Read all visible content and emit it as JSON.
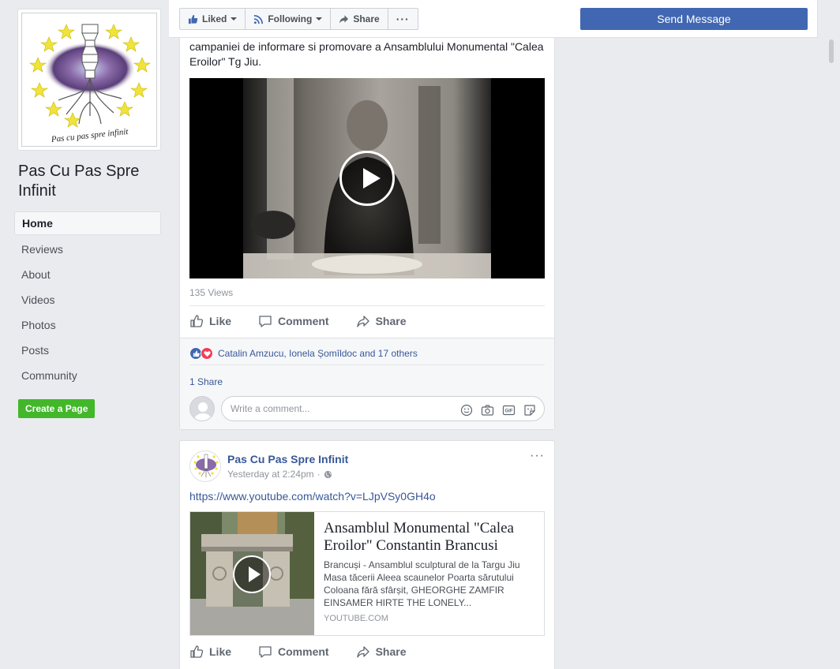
{
  "sidebar": {
    "page_name": "Pas Cu Pas Spre Infinit",
    "logo_text": "Pas cu pas spre infinit",
    "nav": [
      "Home",
      "Reviews",
      "About",
      "Videos",
      "Photos",
      "Posts",
      "Community"
    ],
    "create_page": "Create a Page"
  },
  "toolbar": {
    "liked": "Liked",
    "following": "Following",
    "share": "Share",
    "more": "···",
    "send_message": "Send Message"
  },
  "post1": {
    "text": "campaniei de informare si promovare a Ansamblului Monumental \"Calea Eroilor\" Tg Jiu.",
    "views": "135 Views",
    "actions": {
      "like": "Like",
      "comment": "Comment",
      "share": "Share"
    },
    "reactions_text": "Catalin Amzucu, Ionela Șomîldoc and 17 others",
    "shares": "1 Share",
    "comment_placeholder": "Write a comment..."
  },
  "post2": {
    "author": "Pas Cu Pas Spre Infinit",
    "time": "Yesterday at 2:24pm",
    "more": "···",
    "link": "https://www.youtube.com/watch?v=LJpVSy0GH4o",
    "share_title": "Ansamblul Monumental \"Calea Eroilor\" Constantin Brancusi",
    "share_desc": "Brancuși - Ansamblul sculptural de la Targu Jiu Masa tăcerii Aleea scaunelor Poarta sărutului Coloana fără sfârșit, GHEORGHE ZAMFIR EINSAMER HIRTE THE LONELY...",
    "share_domain": "YOUTUBE.COM",
    "actions": {
      "like": "Like",
      "comment": "Comment",
      "share": "Share"
    }
  },
  "colors": {
    "brand_blue": "#4267b2",
    "link_blue": "#385898",
    "create_green": "#42b72a",
    "love_red": "#f33e58"
  },
  "icons": [
    "thumbs-up-icon",
    "rss-icon",
    "share-arrow-icon",
    "more-icon",
    "comment-icon",
    "play-icon",
    "emoji-icon",
    "camera-icon",
    "gif-icon",
    "sticker-icon",
    "globe-icon"
  ]
}
